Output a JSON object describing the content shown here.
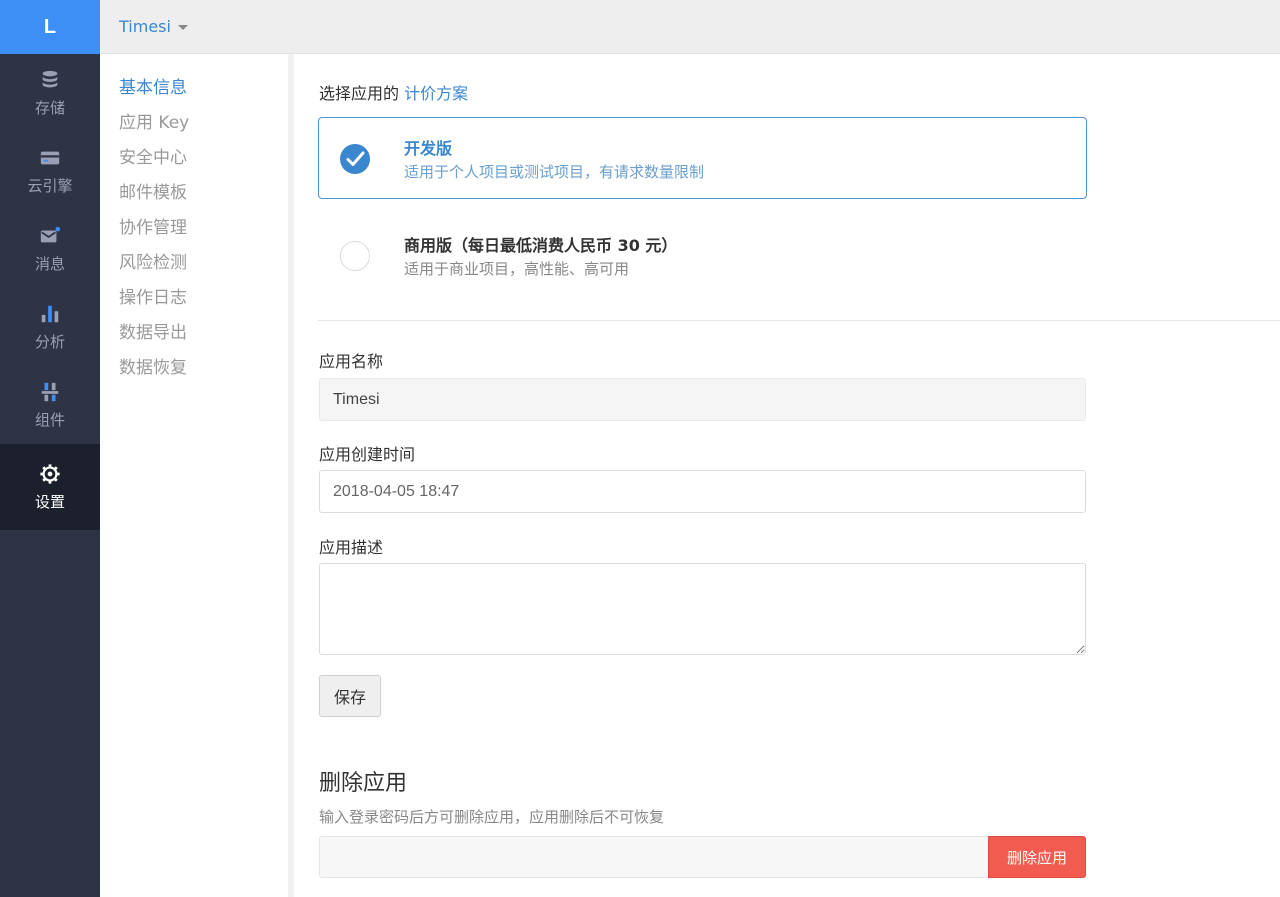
{
  "rail": {
    "logo": "L",
    "items": [
      {
        "label": "存储",
        "icon": "database-icon"
      },
      {
        "label": "云引擎",
        "icon": "cloud-engine-icon"
      },
      {
        "label": "消息",
        "icon": "message-icon"
      },
      {
        "label": "分析",
        "icon": "bar-chart-icon"
      },
      {
        "label": "组件",
        "icon": "components-icon"
      },
      {
        "label": "设置",
        "icon": "gear-icon"
      }
    ],
    "active": "设置"
  },
  "topbar": {
    "app_name": "Timesi"
  },
  "subnav": {
    "items": [
      "基本信息",
      "应用 Key",
      "安全中心",
      "邮件模板",
      "协作管理",
      "风险检测",
      "操作日志",
      "数据导出",
      "数据恢复"
    ],
    "active": "基本信息"
  },
  "pricing": {
    "title_prefix": "选择应用的",
    "title_link": "计价方案",
    "plans": [
      {
        "name": "开发版",
        "desc": "适用于个人项目或测试项目，有请求数量限制",
        "selected": true
      },
      {
        "name": "商用版（每日最低消费人民币 30 元）",
        "desc": "适用于商业项目，高性能、高可用",
        "selected": false
      }
    ]
  },
  "form": {
    "name_label": "应用名称",
    "name_value": "Timesi",
    "created_label": "应用创建时间",
    "created_value": "2018-04-05 18:47",
    "desc_label": "应用描述",
    "desc_value": "",
    "save_label": "保存"
  },
  "delete": {
    "title": "删除应用",
    "desc": "输入登录密码后方可删除应用，应用删除后不可恢复",
    "password_value": "",
    "button_label": "删除应用"
  },
  "colors": {
    "accent": "#3a87cf",
    "logo_bg": "#3d8ff6",
    "rail_bg": "#2f3346",
    "rail_active_bg": "#1c1f2c",
    "danger": "#f25b50"
  }
}
